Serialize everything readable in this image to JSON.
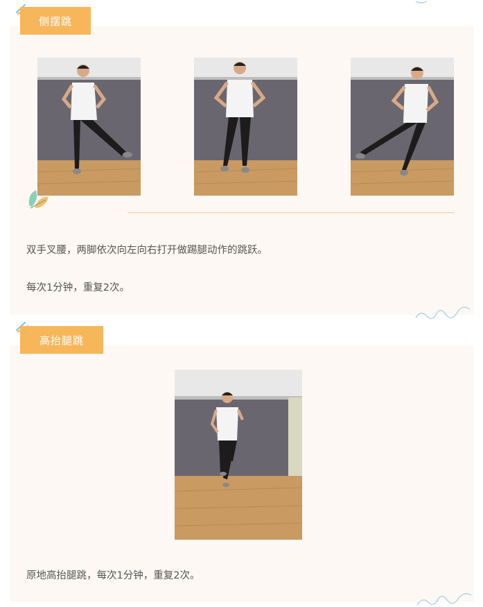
{
  "sections": [
    {
      "tag_label": "侧摆跳",
      "photos": [
        {
          "name": "photo-left-kick",
          "pose": "left-kick"
        },
        {
          "name": "photo-standing",
          "pose": "standing"
        },
        {
          "name": "photo-right-kick",
          "pose": "right-kick"
        }
      ],
      "description": "双手叉腰，两脚依次向左向右打开做踢腿动作的跳跃。",
      "repetition": "每次1分钟，重复2次。"
    },
    {
      "tag_label": "高抬腿跳",
      "photos": [
        {
          "name": "photo-high-knee",
          "pose": "high-knee"
        }
      ],
      "description": "原地高抬腿跳，每次1分钟，重复2次。"
    }
  ],
  "colors": {
    "tag_bg": "#f8b65a",
    "card_bg": "#fdf8f3",
    "divider": "#f2cc99",
    "wave": "#a9d3ea",
    "text": "#555555"
  },
  "icons": [
    "leaf-icon",
    "wave-decoration-icon",
    "brush-stroke-icon"
  ]
}
